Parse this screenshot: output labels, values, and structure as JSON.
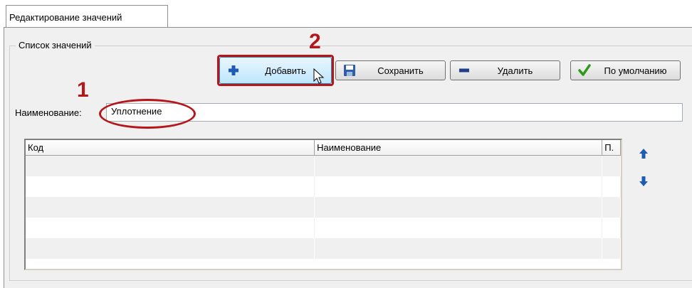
{
  "tab": {
    "label": "Редактирование значений"
  },
  "group": {
    "legend": "Список значений"
  },
  "toolbar": {
    "add_label": "Добавить",
    "save_label": "Сохранить",
    "delete_label": "Удалить",
    "default_label": "По умолчанию"
  },
  "callouts": {
    "one": "1",
    "two": "2"
  },
  "name_field": {
    "label": "Наименование:",
    "value": "Уплотнение"
  },
  "grid": {
    "columns": [
      "Код",
      "Наименование",
      "П."
    ],
    "rows": [
      [
        "",
        "",
        ""
      ],
      [
        "",
        "",
        ""
      ],
      [
        "",
        "",
        ""
      ],
      [
        "",
        "",
        ""
      ],
      [
        "",
        "",
        ""
      ]
    ]
  },
  "icons": {
    "add": "plus-icon",
    "save": "floppy-disk-icon",
    "delete": "minus-icon",
    "default": "check-icon",
    "move_up": "arrow-up-icon",
    "move_down": "arrow-down-icon",
    "cursor": "mouse-pointer-icon"
  },
  "colors": {
    "callout": "#b3171c",
    "icon_blue": "#1e5bb5",
    "check_green": "#2e9a1b"
  }
}
